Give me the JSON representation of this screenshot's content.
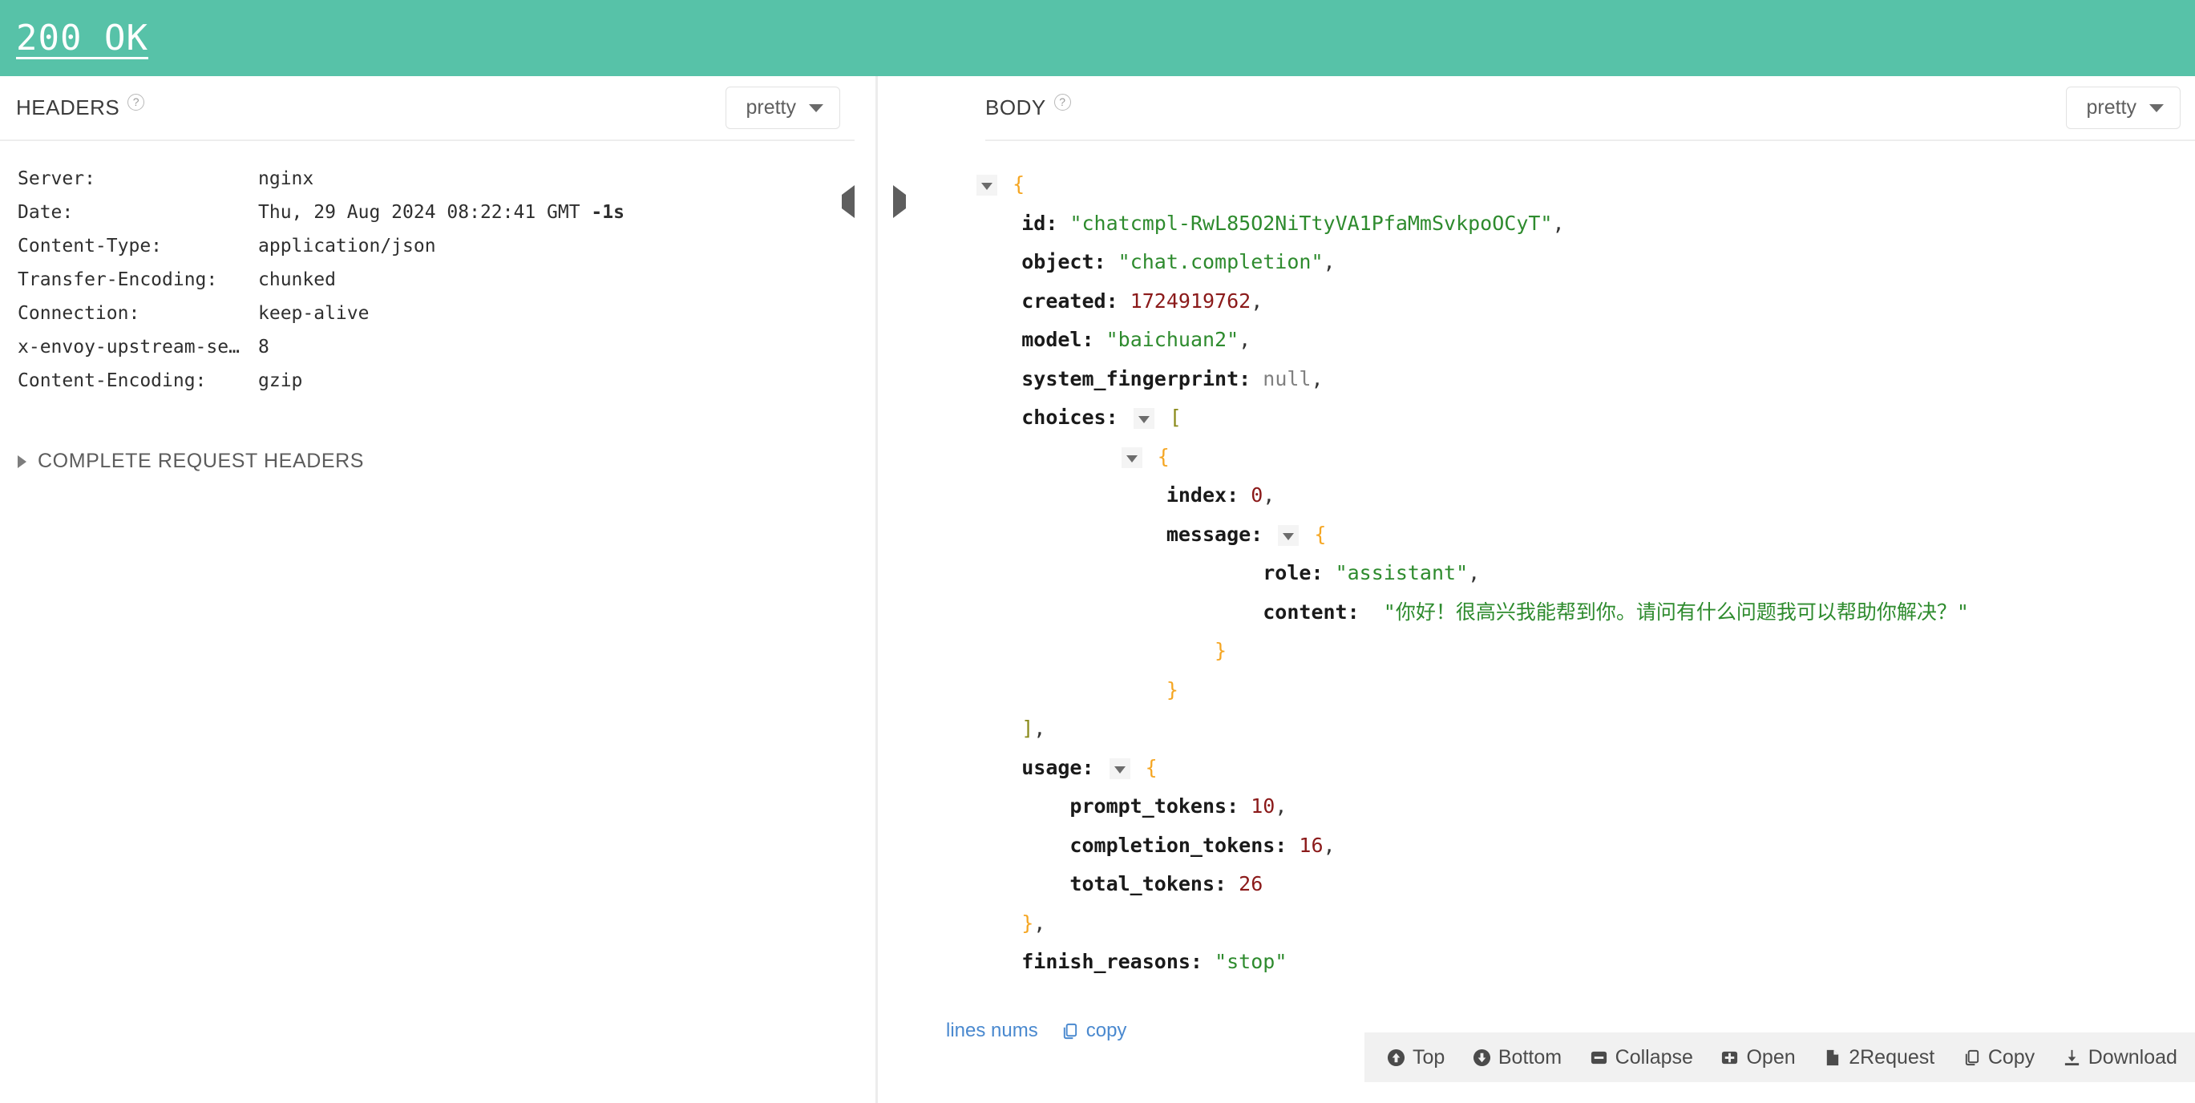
{
  "status": {
    "text": "200 OK",
    "banner_color": "#57c2a8"
  },
  "left_panel": {
    "title": "HEADERS",
    "help_icon": "question-circle-icon",
    "format_select": {
      "value": "pretty"
    },
    "headers": [
      {
        "key": "Server:",
        "value": "nginx",
        "suffix": ""
      },
      {
        "key": "Date:",
        "value": "Thu, 29 Aug 2024 08:22:41 GMT",
        "suffix": "-1s"
      },
      {
        "key": "Content-Type:",
        "value": "application/json",
        "suffix": ""
      },
      {
        "key": "Transfer-Encoding:",
        "value": "chunked",
        "suffix": ""
      },
      {
        "key": "Connection:",
        "value": "keep-alive",
        "suffix": ""
      },
      {
        "key": "x-envoy-upstream-se…",
        "value": "8",
        "suffix": ""
      },
      {
        "key": "Content-Encoding:",
        "value": "gzip",
        "suffix": ""
      }
    ],
    "complete_request_headers": "COMPLETE REQUEST HEADERS"
  },
  "collapse_controls": {
    "left_arrow_icon": "triangle-left-icon",
    "right_arrow_icon": "triangle-right-icon"
  },
  "right_panel": {
    "title": "BODY",
    "help_icon": "question-circle-icon",
    "format_select": {
      "value": "pretty"
    },
    "json_lines": [
      {
        "indent": 0,
        "toggle": true,
        "parts": [
          {
            "t": "{",
            "c": "jbrace"
          }
        ]
      },
      {
        "indent": 1,
        "parts": [
          {
            "t": "id:",
            "c": "jkey"
          },
          {
            "t": " ",
            "c": "jpunc"
          },
          {
            "t": "\"chatcmpl-RwL85O2NiTtyVA1PfaMmSvkpoOCyT\"",
            "c": "jstr"
          },
          {
            "t": ",",
            "c": "jpunc"
          }
        ]
      },
      {
        "indent": 1,
        "parts": [
          {
            "t": "object:",
            "c": "jkey"
          },
          {
            "t": " ",
            "c": "jpunc"
          },
          {
            "t": "\"chat.completion\"",
            "c": "jstr"
          },
          {
            "t": ",",
            "c": "jpunc"
          }
        ]
      },
      {
        "indent": 1,
        "parts": [
          {
            "t": "created:",
            "c": "jkey"
          },
          {
            "t": " ",
            "c": "jpunc"
          },
          {
            "t": "1724919762",
            "c": "jnum"
          },
          {
            "t": ",",
            "c": "jpunc"
          }
        ]
      },
      {
        "indent": 1,
        "parts": [
          {
            "t": "model:",
            "c": "jkey"
          },
          {
            "t": " ",
            "c": "jpunc"
          },
          {
            "t": "\"baichuan2\"",
            "c": "jstr"
          },
          {
            "t": ",",
            "c": "jpunc"
          }
        ]
      },
      {
        "indent": 1,
        "parts": [
          {
            "t": "system_fingerprint:",
            "c": "jkey"
          },
          {
            "t": " ",
            "c": "jpunc"
          },
          {
            "t": "null",
            "c": "jnull"
          },
          {
            "t": ",",
            "c": "jpunc"
          }
        ]
      },
      {
        "indent": 1,
        "toggle": true,
        "prefix": {
          "t": "choices:",
          "c": "jkey"
        },
        "parts": [
          {
            "t": "[",
            "c": "jbracket"
          }
        ]
      },
      {
        "indent": 3,
        "toggle": true,
        "parts": [
          {
            "t": "{",
            "c": "jbrace"
          }
        ]
      },
      {
        "indent": 4,
        "parts": [
          {
            "t": "index:",
            "c": "jkey"
          },
          {
            "t": " ",
            "c": "jpunc"
          },
          {
            "t": "0",
            "c": "jnum"
          },
          {
            "t": ",",
            "c": "jpunc"
          }
        ]
      },
      {
        "indent": 4,
        "toggle": true,
        "prefix": {
          "t": "message:",
          "c": "jkey"
        },
        "parts": [
          {
            "t": "{",
            "c": "jbrace"
          }
        ]
      },
      {
        "indent": 6,
        "parts": [
          {
            "t": "role:",
            "c": "jkey"
          },
          {
            "t": " ",
            "c": "jpunc"
          },
          {
            "t": "\"assistant\"",
            "c": "jstr"
          },
          {
            "t": ",",
            "c": "jpunc"
          }
        ]
      },
      {
        "indent": 6,
        "parts": [
          {
            "t": "content:",
            "c": "jkey"
          },
          {
            "t": "  ",
            "c": "jpunc"
          },
          {
            "t": "\"你好！很高兴我能帮到你。请问有什么问题我可以帮助你解决？\"",
            "c": "jstr"
          }
        ]
      },
      {
        "indent": 5,
        "parts": [
          {
            "t": "}",
            "c": "jbrace"
          }
        ]
      },
      {
        "indent": 4,
        "parts": [
          {
            "t": "}",
            "c": "jbrace"
          }
        ]
      },
      {
        "indent": 1,
        "parts": [
          {
            "t": "]",
            "c": "jbracket"
          },
          {
            "t": ",",
            "c": "jpunc"
          }
        ]
      },
      {
        "indent": 1,
        "toggle": true,
        "prefix": {
          "t": "usage:",
          "c": "jkey"
        },
        "parts": [
          {
            "t": "{",
            "c": "jbrace"
          }
        ]
      },
      {
        "indent": 2,
        "parts": [
          {
            "t": "prompt_tokens:",
            "c": "jkey"
          },
          {
            "t": " ",
            "c": "jpunc"
          },
          {
            "t": "10",
            "c": "jnum"
          },
          {
            "t": ",",
            "c": "jpunc"
          }
        ]
      },
      {
        "indent": 2,
        "parts": [
          {
            "t": "completion_tokens:",
            "c": "jkey"
          },
          {
            "t": " ",
            "c": "jpunc"
          },
          {
            "t": "16",
            "c": "jnum"
          },
          {
            "t": ",",
            "c": "jpunc"
          }
        ]
      },
      {
        "indent": 2,
        "parts": [
          {
            "t": "total_tokens:",
            "c": "jkey"
          },
          {
            "t": " ",
            "c": "jpunc"
          },
          {
            "t": "26",
            "c": "jnum"
          }
        ]
      },
      {
        "indent": 1,
        "parts": [
          {
            "t": "}",
            "c": "jbrace"
          },
          {
            "t": ",",
            "c": "jpunc"
          }
        ]
      },
      {
        "indent": 1,
        "parts": [
          {
            "t": "finish_reasons:",
            "c": "jkey"
          },
          {
            "t": " ",
            "c": "jpunc"
          },
          {
            "t": "\"stop\"",
            "c": "jstr"
          }
        ]
      },
      {
        "indent": 0,
        "parts": [
          {
            "t": "}",
            "c": "jbrace"
          }
        ]
      }
    ],
    "links": [
      {
        "label": "lines nums",
        "icon": ""
      },
      {
        "label": "copy",
        "icon": "copy-icon"
      }
    ],
    "toolbar": [
      {
        "label": "Top",
        "icon": "arrow-up-circle-icon"
      },
      {
        "label": "Bottom",
        "icon": "arrow-down-circle-icon"
      },
      {
        "label": "Collapse",
        "icon": "minus-square-icon"
      },
      {
        "label": "Open",
        "icon": "plus-square-icon"
      },
      {
        "label": "2Request",
        "icon": "file-icon"
      },
      {
        "label": "Copy",
        "icon": "copy-icon"
      },
      {
        "label": "Download",
        "icon": "download-icon"
      }
    ]
  },
  "colors": {
    "accent": "#57c2a8",
    "link": "#4a89cf",
    "json_string": "#2e8b2e",
    "json_number": "#8b1a1a",
    "json_brace": "#f5a623"
  }
}
